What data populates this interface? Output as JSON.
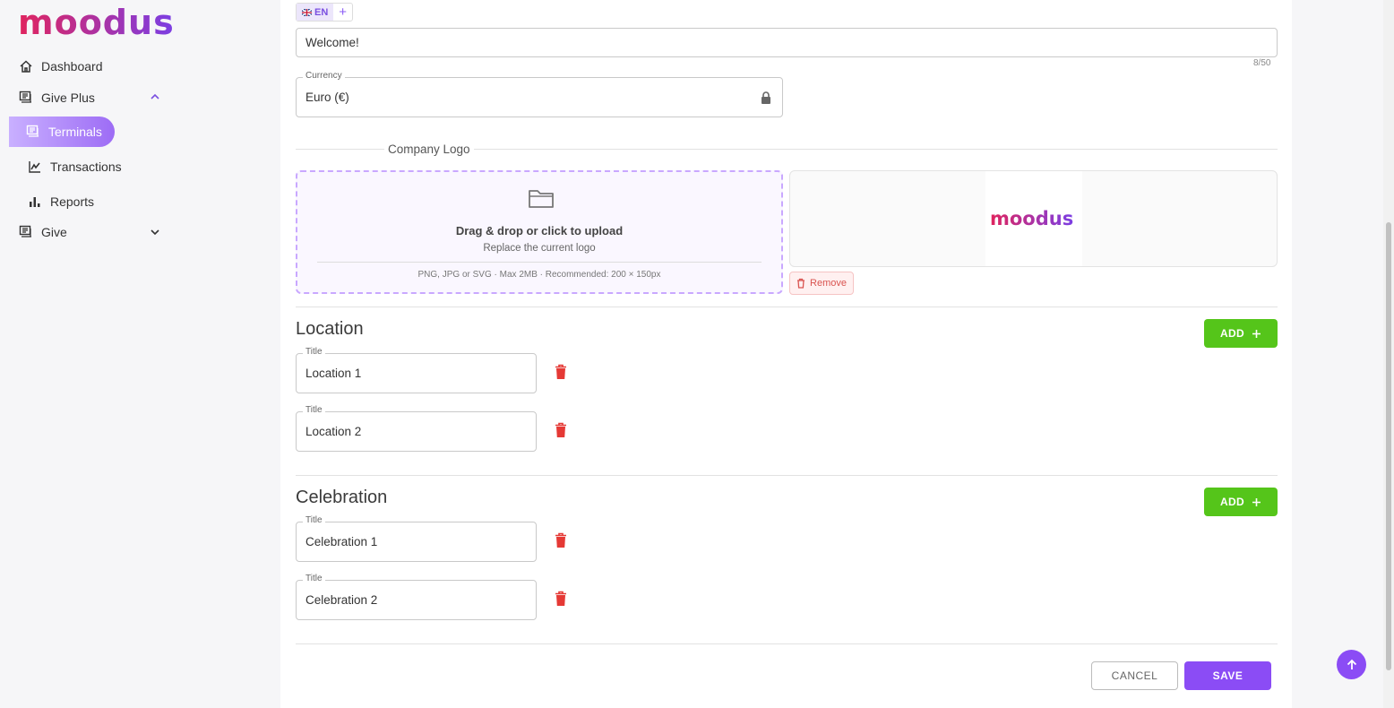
{
  "brand": {
    "logo_text": "moodus",
    "accent": "#8b4cf5",
    "logo_gradient": [
      "#e0245e",
      "#7b3fe4"
    ]
  },
  "sidebar": {
    "items": [
      {
        "label": "Dashboard",
        "icon": "home-icon"
      },
      {
        "label": "Give Plus",
        "icon": "terminal-icon",
        "expanded": true
      },
      {
        "label": "Terminals",
        "icon": "terminal-icon",
        "active": true
      },
      {
        "label": "Transactions",
        "icon": "chart-line-icon"
      },
      {
        "label": "Reports",
        "icon": "bar-chart-icon"
      },
      {
        "label": "Give",
        "icon": "terminal-icon",
        "expanded": false
      }
    ]
  },
  "form": {
    "language": {
      "code": "EN",
      "add_symbol": "+"
    },
    "welcome": {
      "value": "Welcome!",
      "counter": "8/50"
    },
    "currency": {
      "label": "Currency",
      "value": "Euro (€)"
    },
    "company_logo": {
      "legend": "Company Logo",
      "dropzone_title": "Drag & drop or click to upload",
      "dropzone_subtitle": "Replace the current logo",
      "dropzone_hint": "PNG, JPG or SVG · Max 2MB · Recommended: 200 × 150px",
      "remove_label": "Remove"
    },
    "location": {
      "title": "Location",
      "add_label": "ADD",
      "items": [
        {
          "label": "Title",
          "value": "Location 1"
        },
        {
          "label": "Title",
          "value": "Location 2"
        }
      ]
    },
    "celebration": {
      "title": "Celebration",
      "add_label": "ADD",
      "items": [
        {
          "label": "Title",
          "value": "Celebration 1"
        },
        {
          "label": "Title",
          "value": "Celebration 2"
        }
      ]
    },
    "actions": {
      "cancel_label": "CANCEL",
      "save_label": "SAVE"
    }
  }
}
